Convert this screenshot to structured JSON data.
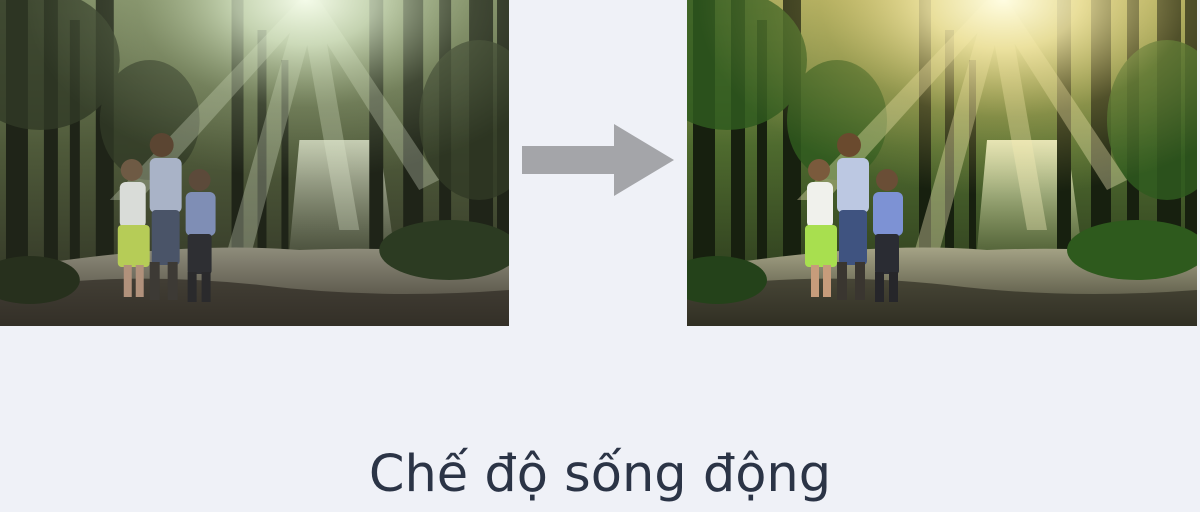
{
  "comparison": {
    "before_image": {
      "label": "",
      "mode": "standard"
    },
    "arrow_icon": "right-arrow-icon",
    "after_image": {
      "label": "",
      "mode": "vivid"
    },
    "caption": "Chế độ sống động"
  },
  "colors": {
    "page_background": "#eff1f7",
    "arrow": "#a4a5a9",
    "caption_text": "#2b3446"
  }
}
